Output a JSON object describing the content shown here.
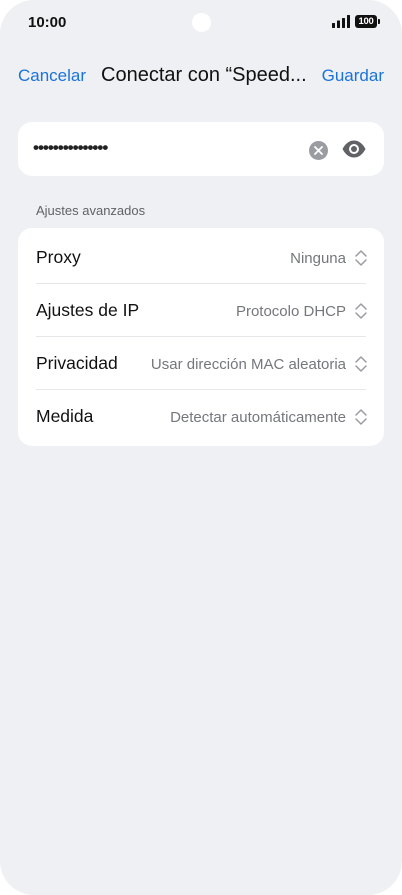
{
  "status_bar": {
    "time": "10:00",
    "battery": "100",
    "icons": [
      "signal-icon",
      "battery-icon"
    ]
  },
  "header": {
    "cancel_label": "Cancelar",
    "title": "Conectar con “Speed...",
    "save_label": "Guardar"
  },
  "password": {
    "masked_value": "•••••••••••••••",
    "icons": [
      "clear-icon",
      "eye-icon"
    ]
  },
  "advanced": {
    "section_label": "Ajustes avanzados",
    "rows": [
      {
        "label": "Proxy",
        "value": "Ninguna"
      },
      {
        "label": "Ajustes de IP",
        "value": "Protocolo DHCP"
      },
      {
        "label": "Privacidad",
        "value": "Usar dirección MAC aleatoria"
      },
      {
        "label": "Medida",
        "value": "Detectar automáticamente"
      }
    ]
  },
  "colors": {
    "accent": "#1a73d9",
    "background": "#eff0f3",
    "card": "#ffffff",
    "secondary_text": "#75777c"
  }
}
